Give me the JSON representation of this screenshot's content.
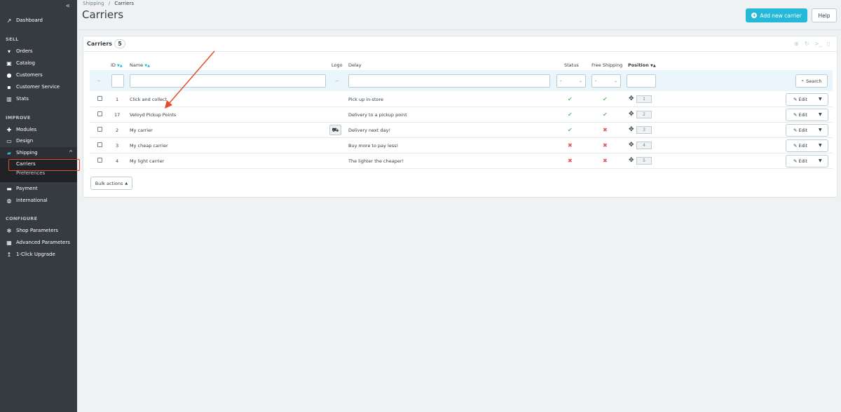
{
  "sidebar": {
    "collapse_icon": "double-chevron-left-icon",
    "dashboard": "Dashboard",
    "sections": {
      "sell": "SELL",
      "improve": "IMPROVE",
      "configure": "CONFIGURE"
    },
    "sell_items": [
      "Orders",
      "Catalog",
      "Customers",
      "Customer Service",
      "Stats"
    ],
    "improve_items": [
      "Modules",
      "Design",
      "Shipping"
    ],
    "shipping_sub": [
      "Carriers",
      "Preferences"
    ],
    "more_items": [
      "Payment",
      "International"
    ],
    "configure_items": [
      "Shop Parameters",
      "Advanced Parameters",
      "1-Click Upgrade"
    ],
    "accent_color": "#25b9d7"
  },
  "header": {
    "breadcrumb_parent": "Shipping",
    "breadcrumb_sep": "/",
    "breadcrumb_current": "Carriers",
    "title": "Carriers",
    "add_button": "Add new carrier",
    "help_button": "Help"
  },
  "panel": {
    "title": "Carriers",
    "count": "5",
    "columns": {
      "id": "ID",
      "name": "Name",
      "logo": "Logo",
      "delay": "Delay",
      "status": "Status",
      "free_shipping": "Free Shipping",
      "position": "Position"
    },
    "filter": {
      "dash": "--",
      "select_value": "-",
      "search_button": "Search"
    },
    "rows": [
      {
        "id": "1",
        "name": "Click and collect",
        "delay": "Pick up in-store",
        "status": true,
        "free": true,
        "position": "1",
        "logo": false
      },
      {
        "id": "17",
        "name": "Veloyd Pickup Points",
        "delay": "Delivery to a pickup point",
        "status": true,
        "free": true,
        "position": "2",
        "logo": false
      },
      {
        "id": "2",
        "name": "My carrier",
        "delay": "Delivery next day!",
        "status": true,
        "free": false,
        "position": "3",
        "logo": true
      },
      {
        "id": "3",
        "name": "My cheap carrier",
        "delay": "Buy more to pay less!",
        "status": false,
        "free": false,
        "position": "4",
        "logo": false
      },
      {
        "id": "4",
        "name": "My light carrier",
        "delay": "The lighter the cheaper!",
        "status": false,
        "free": false,
        "position": "5",
        "logo": false
      }
    ],
    "edit_label": "Edit",
    "bulk_actions": "Bulk actions"
  }
}
